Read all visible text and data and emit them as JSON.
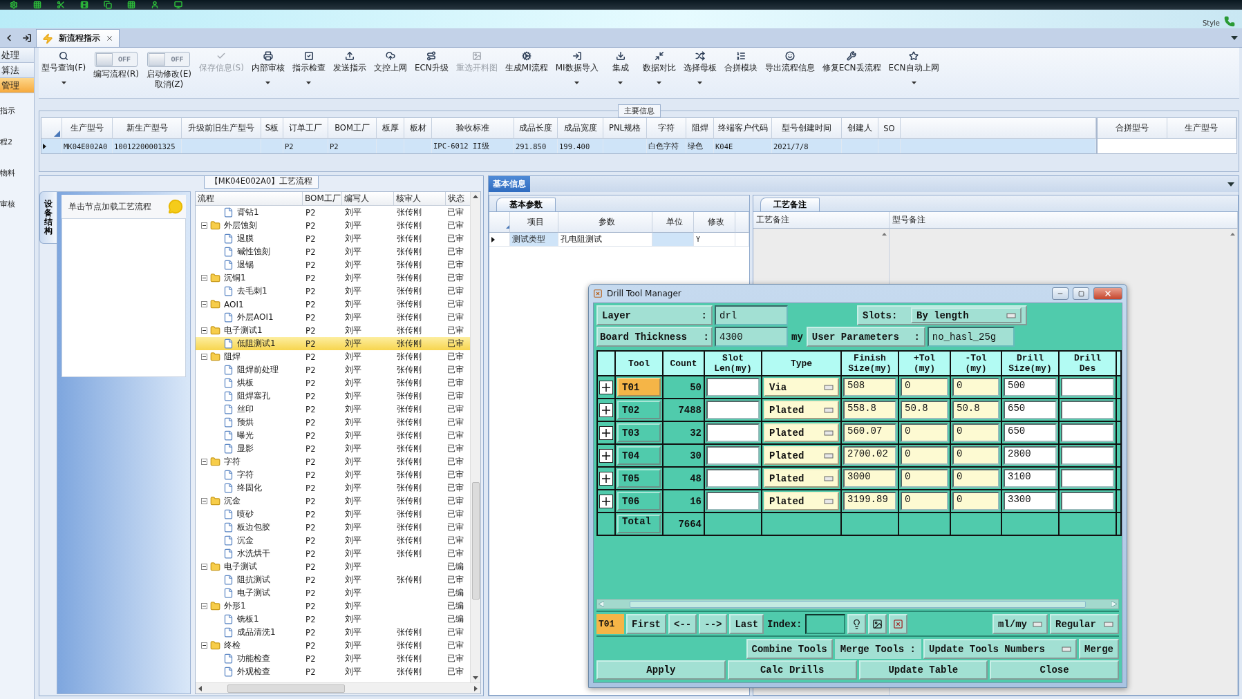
{
  "banner": {
    "style_label": "Style"
  },
  "tabs": [
    {
      "label": "新流程指示",
      "selected": true,
      "closable": true
    }
  ],
  "left_nav": {
    "items": [
      {
        "label": "处理",
        "selected": false
      },
      {
        "label": "算法",
        "selected": false
      },
      {
        "label": "管理",
        "selected": true
      }
    ],
    "links": [
      {
        "label": "指示"
      },
      {
        "label": "程2"
      },
      {
        "label": "物料"
      },
      {
        "label": "审核"
      }
    ]
  },
  "toolbar": [
    {
      "kind": "button",
      "label": "型号查询(F)",
      "dropdown": true,
      "disabled": false
    },
    {
      "kind": "toggle",
      "label": "编写流程(R)",
      "switch_text": "OFF",
      "on": false
    },
    {
      "kind": "toggle",
      "label": "启动修改(E)\n取消(Z)",
      "switch_text": "OFF",
      "on": false
    },
    {
      "kind": "button",
      "label": "保存信息(S)",
      "dropdown": false,
      "disabled": true
    },
    {
      "kind": "button",
      "label": "内部审核",
      "dropdown": true,
      "disabled": false
    },
    {
      "kind": "button",
      "label": "指示检查",
      "dropdown": true,
      "disabled": false
    },
    {
      "kind": "button",
      "label": "发送指示",
      "dropdown": false,
      "disabled": false
    },
    {
      "kind": "button",
      "label": "文控上网",
      "dropdown": false,
      "disabled": false
    },
    {
      "kind": "button",
      "label": "ECN升级",
      "dropdown": false,
      "disabled": false
    },
    {
      "kind": "button",
      "label": "重选开料图",
      "dropdown": false,
      "disabled": true
    },
    {
      "kind": "button",
      "label": "生成MI流程",
      "dropdown": false,
      "disabled": false
    },
    {
      "kind": "button",
      "label": "MI数据导入",
      "dropdown": true,
      "disabled": false
    },
    {
      "kind": "button",
      "label": "集成",
      "dropdown": true,
      "disabled": false
    },
    {
      "kind": "button",
      "label": "数据对比",
      "dropdown": true,
      "disabled": false
    },
    {
      "kind": "button",
      "label": "选择母板",
      "dropdown": true,
      "disabled": false
    },
    {
      "kind": "button",
      "label": "合拼模块",
      "dropdown": false,
      "disabled": false
    },
    {
      "kind": "button",
      "label": "导出流程信息",
      "dropdown": false,
      "disabled": false
    },
    {
      "kind": "button",
      "label": "修复ECN丢流程",
      "dropdown": false,
      "disabled": false
    },
    {
      "kind": "button",
      "label": "ECN自动上网",
      "dropdown": true,
      "disabled": false
    }
  ],
  "main_info": {
    "title": "主要信息",
    "columns": [
      {
        "label": "生产型号",
        "value": "MK04E002A0"
      },
      {
        "label": "新生产型号",
        "value": "10012200001325"
      },
      {
        "label": "升级前旧生产型号"
      },
      {
        "label": "S板"
      },
      {
        "label": "订单工厂",
        "value": "P2"
      },
      {
        "label": "BOM工厂",
        "value": "P2"
      },
      {
        "label": "板厚"
      },
      {
        "label": "板材"
      },
      {
        "label": "验收标准",
        "value": "IPC-6012 II级"
      },
      {
        "label": "成品长度",
        "value": "291.850"
      },
      {
        "label": "成品宽度",
        "value": "199.400"
      },
      {
        "label": "PNL规格"
      },
      {
        "label": "字符",
        "value": "白色字符"
      },
      {
        "label": "阻焊",
        "value": "绿色"
      },
      {
        "label": "终端客户代码",
        "value": "K04E"
      },
      {
        "label": "型号创建时间",
        "value": "2021/7/8"
      },
      {
        "label": "创建人"
      },
      {
        "label": "SO"
      }
    ],
    "side_columns": [
      "合拼型号",
      "生产型号"
    ]
  },
  "process": {
    "title": "【MK04E002A0】工艺流程",
    "side_tab": "设备结构",
    "hint": "单击节点加载工艺流程",
    "columns": [
      "流程",
      "BOM工厂",
      "编写人",
      "核审人",
      "状态"
    ],
    "tree": [
      {
        "children": [
          {
            "label": "背钻1",
            "bom": "P2",
            "writer": "刘平",
            "reviewer": "张传刚",
            "status": "已审",
            "selected": false
          }
        ]
      },
      {
        "label": "外层蚀刻",
        "bom": "P2",
        "writer": "刘平",
        "reviewer": "张传刚",
        "status": "已审",
        "selected": false,
        "expanded": true,
        "children": [
          {
            "label": "退膜",
            "bom": "P2",
            "writer": "刘平",
            "reviewer": "张传刚",
            "status": "已审",
            "selected": false
          },
          {
            "label": "碱性蚀刻",
            "bom": "P2",
            "writer": "刘平",
            "reviewer": "张传刚",
            "status": "已审",
            "selected": false
          },
          {
            "label": "退锡",
            "bom": "P2",
            "writer": "刘平",
            "reviewer": "张传刚",
            "status": "已审",
            "selected": false
          }
        ]
      },
      {
        "label": "沉铜1",
        "bom": "P2",
        "writer": "刘平",
        "reviewer": "张传刚",
        "status": "已审",
        "selected": false,
        "expanded": true,
        "children": [
          {
            "label": "去毛刺1",
            "bom": "P2",
            "writer": "刘平",
            "reviewer": "张传刚",
            "status": "已审",
            "selected": false
          }
        ]
      },
      {
        "label": "AOI1",
        "bom": "P2",
        "writer": "刘平",
        "reviewer": "张传刚",
        "status": "已审",
        "selected": false,
        "expanded": true,
        "children": [
          {
            "label": "外层AOI1",
            "bom": "P2",
            "writer": "刘平",
            "reviewer": "张传刚",
            "status": "已审",
            "selected": false
          }
        ]
      },
      {
        "label": "电子测试1",
        "bom": "P2",
        "writer": "刘平",
        "reviewer": "张传刚",
        "status": "已审",
        "selected": false,
        "expanded": true,
        "children": [
          {
            "label": "低阻测试1",
            "bom": "P2",
            "writer": "刘平",
            "reviewer": "张传刚",
            "status": "已审",
            "selected": true
          }
        ]
      },
      {
        "label": "阻焊",
        "bom": "P2",
        "writer": "刘平",
        "reviewer": "张传刚",
        "status": "已审",
        "selected": false,
        "expanded": true,
        "children": [
          {
            "label": "阻焊前处理",
            "bom": "P2",
            "writer": "刘平",
            "reviewer": "张传刚",
            "status": "已审",
            "selected": false
          },
          {
            "label": "烘板",
            "bom": "P2",
            "writer": "刘平",
            "reviewer": "张传刚",
            "status": "已审",
            "selected": false
          },
          {
            "label": "阻焊塞孔",
            "bom": "P2",
            "writer": "刘平",
            "reviewer": "张传刚",
            "status": "已审",
            "selected": false
          },
          {
            "label": "丝印",
            "bom": "P2",
            "writer": "刘平",
            "reviewer": "张传刚",
            "status": "已审",
            "selected": false
          },
          {
            "label": "预烘",
            "bom": "P2",
            "writer": "刘平",
            "reviewer": "张传刚",
            "status": "已审",
            "selected": false
          },
          {
            "label": "曝光",
            "bom": "P2",
            "writer": "刘平",
            "reviewer": "张传刚",
            "status": "已审",
            "selected": false
          },
          {
            "label": "显影",
            "bom": "P2",
            "writer": "刘平",
            "reviewer": "张传刚",
            "status": "已审",
            "selected": false
          }
        ]
      },
      {
        "label": "字符",
        "bom": "P2",
        "writer": "刘平",
        "reviewer": "张传刚",
        "status": "已审",
        "selected": false,
        "expanded": true,
        "children": [
          {
            "label": "字符",
            "bom": "P2",
            "writer": "刘平",
            "reviewer": "张传刚",
            "status": "已审",
            "selected": false
          },
          {
            "label": "终固化",
            "bom": "P2",
            "writer": "刘平",
            "reviewer": "张传刚",
            "status": "已审",
            "selected": false
          }
        ]
      },
      {
        "label": "沉金",
        "bom": "P2",
        "writer": "刘平",
        "reviewer": "张传刚",
        "status": "已审",
        "selected": false,
        "expanded": true,
        "children": [
          {
            "label": "喷砂",
            "bom": "P2",
            "writer": "刘平",
            "reviewer": "张传刚",
            "status": "已审",
            "selected": false
          },
          {
            "label": "板边包胶",
            "bom": "P2",
            "writer": "刘平",
            "reviewer": "张传刚",
            "status": "已审",
            "selected": false
          },
          {
            "label": "沉金",
            "bom": "P2",
            "writer": "刘平",
            "reviewer": "张传刚",
            "status": "已审",
            "selected": false
          },
          {
            "label": "水洗烘干",
            "bom": "P2",
            "writer": "刘平",
            "reviewer": "张传刚",
            "status": "已审",
            "selected": false
          }
        ]
      },
      {
        "label": "电子测试",
        "bom": "P2",
        "writer": "刘平",
        "status": "已编",
        "selected": false,
        "expanded": true,
        "children": [
          {
            "label": "阻抗测试",
            "bom": "P2",
            "writer": "刘平",
            "reviewer": "张传刚",
            "status": "已审",
            "selected": false
          },
          {
            "label": "电子测试",
            "bom": "P2",
            "writer": "刘平",
            "status": "已编",
            "selected": false
          }
        ]
      },
      {
        "label": "外形1",
        "bom": "P2",
        "writer": "刘平",
        "status": "已编",
        "selected": false,
        "expanded": true,
        "children": [
          {
            "label": "铣板1",
            "bom": "P2",
            "writer": "刘平",
            "status": "已编",
            "selected": false
          },
          {
            "label": "成品清洗1",
            "bom": "P2",
            "writer": "刘平",
            "reviewer": "张传刚",
            "status": "已审",
            "selected": false
          }
        ]
      },
      {
        "label": "终检",
        "bom": "P2",
        "writer": "刘平",
        "reviewer": "张传刚",
        "status": "已审",
        "selected": false,
        "expanded": true,
        "children": [
          {
            "label": "功能检查",
            "bom": "P2",
            "writer": "刘平",
            "reviewer": "张传刚",
            "status": "已审",
            "selected": false
          },
          {
            "label": "外观检查",
            "bom": "P2",
            "writer": "刘平",
            "reviewer": "张传刚",
            "status": "已审",
            "selected": false
          }
        ]
      }
    ]
  },
  "basic_info": {
    "title": "基本信息",
    "params_tab": "基本参数",
    "params_columns": [
      "项目",
      "参数",
      "单位",
      "修改"
    ],
    "params_rows": [
      {
        "item": "测试类型",
        "value": "孔电阻测试",
        "edited": "Y"
      }
    ],
    "notes_tab": "工艺备注",
    "notes_columns": [
      "工艺备注",
      "型号备注"
    ]
  },
  "drill": {
    "title": "Drill Tool Manager",
    "layer": {
      "label": "Layer",
      "colon": ":",
      "value": "drl"
    },
    "slots": {
      "label": "Slots:",
      "value": "By length"
    },
    "thickness": {
      "label": "Board Thickness",
      "colon": ":",
      "value": "4300",
      "unit": "my"
    },
    "user_params": {
      "label": "User Parameters",
      "colon": ":",
      "value": "no_hasl_25g"
    },
    "columns": [
      "Tool",
      "Count",
      "Slot\nLen(my)",
      "Type",
      "Finish\nSize(my)",
      "+Tol\n(my)",
      "-Tol\n(my)",
      "Drill\nSize(my)",
      "Drill\nDes"
    ],
    "tools": [
      {
        "tool": "T01",
        "count": "50",
        "type": "Via",
        "finish": "508",
        "plus_tol": "0",
        "minus_tol": "0",
        "drill": "500",
        "selected": true
      },
      {
        "tool": "T02",
        "count": "7488",
        "type": "Plated",
        "finish": "558.8",
        "plus_tol": "50.8",
        "minus_tol": "50.8",
        "drill": "650",
        "selected": false
      },
      {
        "tool": "T03",
        "count": "32",
        "type": "Plated",
        "finish": "560.07",
        "plus_tol": "0",
        "minus_tol": "0",
        "drill": "650",
        "selected": false
      },
      {
        "tool": "T04",
        "count": "30",
        "type": "Plated",
        "finish": "2700.02",
        "plus_tol": "0",
        "minus_tol": "0",
        "drill": "2800",
        "selected": false
      },
      {
        "tool": "T05",
        "count": "48",
        "type": "Plated",
        "finish": "3000",
        "plus_tol": "0",
        "minus_tol": "0",
        "drill": "3100",
        "selected": false
      },
      {
        "tool": "T06",
        "count": "16",
        "type": "Plated",
        "finish": "3199.89",
        "plus_tol": "0",
        "minus_tol": "0",
        "drill": "3300",
        "selected": false
      }
    ],
    "total": {
      "label": "Total",
      "count": "7664"
    },
    "nav": {
      "current": "T01",
      "buttons": [
        "First",
        "<--",
        "-->",
        "Last"
      ],
      "index_label": "Index:",
      "units": "ml/my",
      "mode": "Regular"
    },
    "merge": {
      "combine": "Combine Tools",
      "label": "Merge Tools :",
      "option": "Update Tools Numbers",
      "button": "Merge"
    },
    "actions": [
      "Apply",
      "Calc Drills",
      "Update Table",
      "Close"
    ]
  }
}
